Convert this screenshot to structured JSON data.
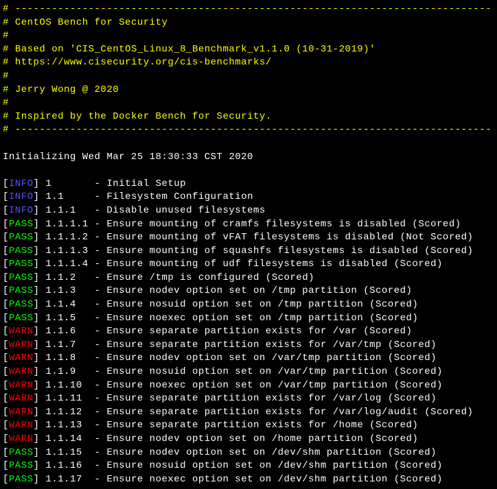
{
  "header": {
    "hash": "# ",
    "dashline": "# ------------------------------------------------------------------------------",
    "title": "CentOS Bench for Security",
    "based_on": "Based on 'CIS_CentOS_Linux_8_Benchmark_v1.1.0 (10-31-2019)'",
    "url": "https://www.cisecurity.org/cis-benchmarks/",
    "author": "Jerry Wong @ 2020",
    "inspired": "Inspired by the Docker Bench for Security."
  },
  "init_line": "Initializing Wed Mar 25 18:30:33 CST 2020",
  "checks": [
    {
      "status": "INFO",
      "id": "1      ",
      "desc": "Initial Setup"
    },
    {
      "status": "INFO",
      "id": "1.1    ",
      "desc": "Filesystem Configuration"
    },
    {
      "status": "INFO",
      "id": "1.1.1  ",
      "desc": "Disable unused filesystems"
    },
    {
      "status": "PASS",
      "id": "1.1.1.1",
      "desc": "Ensure mounting of cramfs filesystems is disabled (Scored)"
    },
    {
      "status": "PASS",
      "id": "1.1.1.2",
      "desc": "Ensure mounting of vFAT filesystems is disabled (Not Scored)"
    },
    {
      "status": "PASS",
      "id": "1.1.1.3",
      "desc": "Ensure mounting of squashfs filesystems is disabled (Scored)"
    },
    {
      "status": "PASS",
      "id": "1.1.1.4",
      "desc": "Ensure mounting of udf filesystems is disabled (Scored)"
    },
    {
      "status": "PASS",
      "id": "1.1.2  ",
      "desc": "Ensure /tmp is configured (Scored)"
    },
    {
      "status": "PASS",
      "id": "1.1.3  ",
      "desc": "Ensure nodev option set on /tmp partition (Scored)"
    },
    {
      "status": "PASS",
      "id": "1.1.4  ",
      "desc": "Ensure nosuid option set on /tmp partition (Scored)"
    },
    {
      "status": "PASS",
      "id": "1.1.5  ",
      "desc": "Ensure noexec option set on /tmp partition (Scored)"
    },
    {
      "status": "WARN",
      "id": "1.1.6  ",
      "desc": "Ensure separate partition exists for /var (Scored)"
    },
    {
      "status": "WARN",
      "id": "1.1.7  ",
      "desc": "Ensure separate partition exists for /var/tmp (Scored)"
    },
    {
      "status": "WARN",
      "id": "1.1.8  ",
      "desc": "Ensure nodev option set on /var/tmp partition (Scored)"
    },
    {
      "status": "WARN",
      "id": "1.1.9  ",
      "desc": "Ensure nosuid option set on /var/tmp partition (Scored)"
    },
    {
      "status": "WARN",
      "id": "1.1.10 ",
      "desc": "Ensure noexec option set on /var/tmp partition (Scored)"
    },
    {
      "status": "WARN",
      "id": "1.1.11 ",
      "desc": "Ensure separate partition exists for /var/log (Scored)"
    },
    {
      "status": "WARN",
      "id": "1.1.12 ",
      "desc": "Ensure separate partition exists for /var/log/audit (Scored)"
    },
    {
      "status": "WARN",
      "id": "1.1.13 ",
      "desc": "Ensure separate partition exists for /home (Scored)"
    },
    {
      "status": "WARN",
      "id": "1.1.14 ",
      "desc": "Ensure nodev option set on /home partition (Scored)"
    },
    {
      "status": "PASS",
      "id": "1.1.15 ",
      "desc": "Ensure nodev option set on /dev/shm partition (Scored)"
    },
    {
      "status": "PASS",
      "id": "1.1.16 ",
      "desc": "Ensure nosuid option set on /dev/shm partition (Scored)"
    },
    {
      "status": "PASS",
      "id": "1.1.17 ",
      "desc": "Ensure noexec option set on /dev/shm partition (Scored)"
    }
  ]
}
